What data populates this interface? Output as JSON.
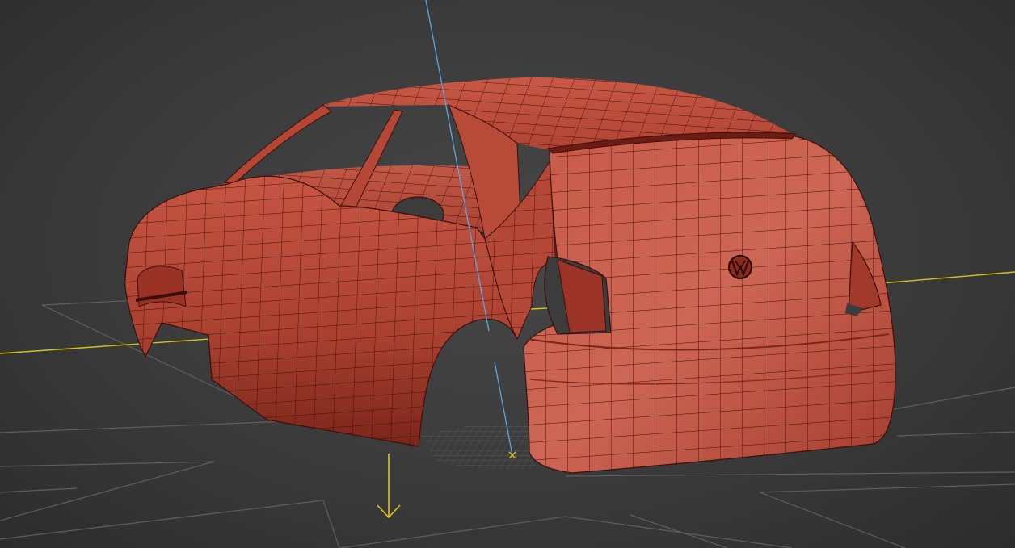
{
  "viewport": {
    "background_color": "#3c3c3c",
    "grid_color": "#6a6a6a",
    "x_axis_color": "#d8c21a",
    "z_axis_color": "#5aa6e0",
    "gizmo_color": "#e3c21c"
  },
  "model": {
    "body_color": "#b84a3a",
    "wire_color": "#3a0f0c",
    "emblem": "VW-logo"
  },
  "icons": {
    "pivot": "pivot-gizmo-icon",
    "arrow": "down-arrow-gizmo-icon"
  }
}
